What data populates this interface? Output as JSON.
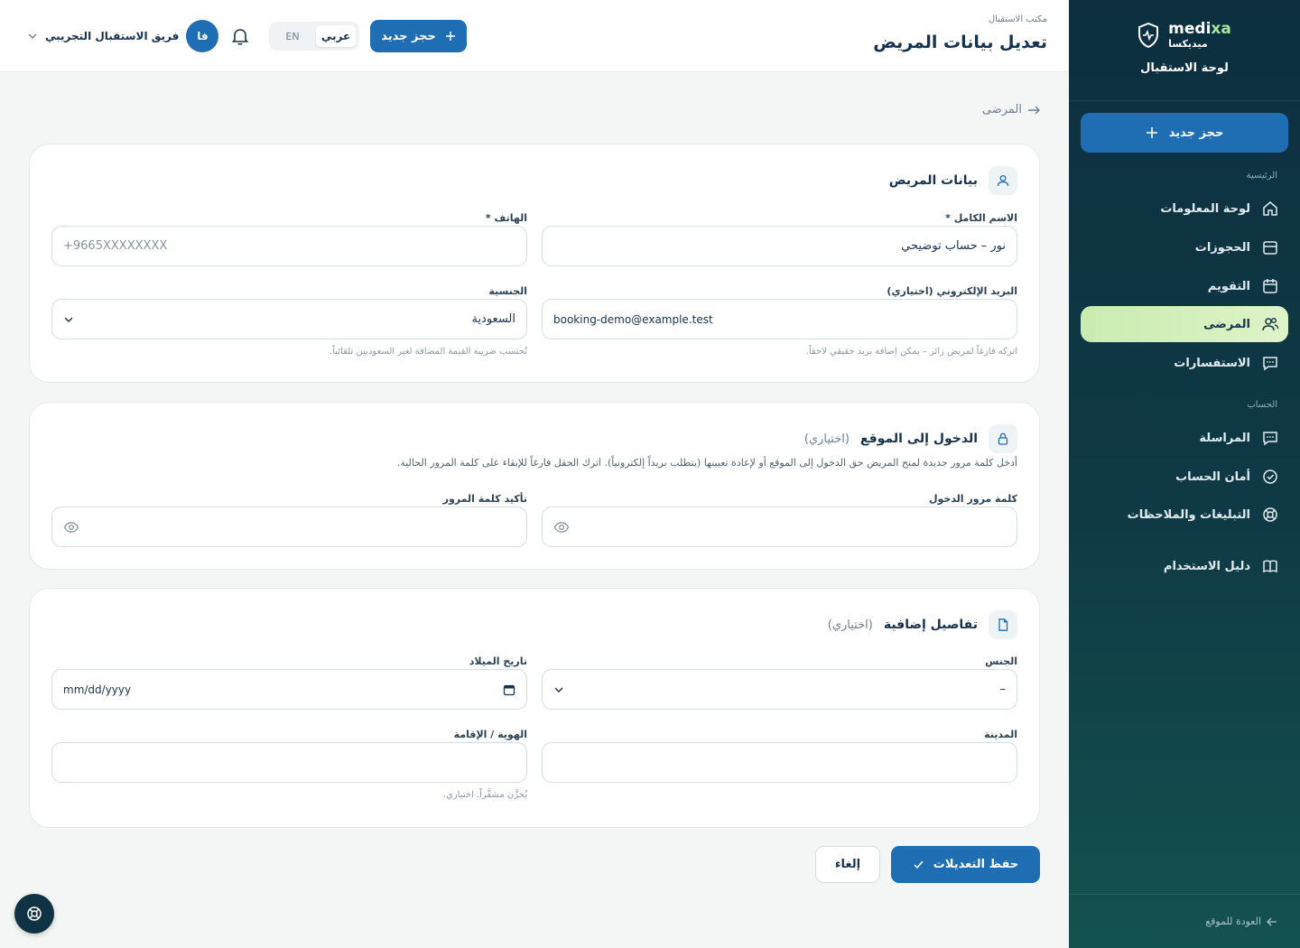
{
  "sidebar": {
    "brand_name_a": "medi",
    "brand_name_b": "xa",
    "brand_name_ar": "ميديكسا",
    "panel_title": "لوحة الاستقبال",
    "new_booking": "حجز جديد",
    "section_main": "الرئيسية",
    "section_account": "الحساب",
    "items": [
      {
        "label": "لوحة المعلومات",
        "icon": "home-icon"
      },
      {
        "label": "الحجوزات",
        "icon": "bookings-icon"
      },
      {
        "label": "التقويم",
        "icon": "calendar-icon"
      },
      {
        "label": "المرضى",
        "icon": "users-icon",
        "active": true
      },
      {
        "label": "الاستفسارات",
        "icon": "chat-icon"
      },
      {
        "label": "المراسلة",
        "icon": "message-icon"
      },
      {
        "label": "أمان الحساب",
        "icon": "shield-check-icon"
      },
      {
        "label": "التبليغات والملاحظات",
        "icon": "lifebuoy-icon"
      },
      {
        "label": "دليل الاستخدام",
        "icon": "book-icon"
      }
    ],
    "back_to_site": "العودة للموقع"
  },
  "topbar": {
    "crumb": "مكتب الاستقبال",
    "title": "تعديل بيانات المريض",
    "new_booking": "حجز جديد",
    "lang_ar": "عربي",
    "lang_en": "EN",
    "user_name": "فريق الاستقبال التجريبي",
    "user_initials": "فا"
  },
  "back_link": "المرضى",
  "patient_card": {
    "title": "بيانات المريض",
    "full_name_label": "الاسم الكامل *",
    "full_name_value": "نور – حساب توضيحي",
    "phone_label": "الهاتف *",
    "phone_placeholder": "+9665XXXXXXXX",
    "email_label": "البريد الإلكتروني (اختياري)",
    "email_value": "booking-demo@example.test",
    "email_hint": "اتركه فارغاً لمريض زائر – يمكن إضافة بريد حقيقي لاحقاً.",
    "nationality_label": "الجنسية",
    "nationality_value": "السعودية",
    "nationality_hint": "تُحتسب ضريبة القيمة المضافة لغير السعوديين تلقائياً."
  },
  "login_card": {
    "title": "الدخول إلى الموقع",
    "optional": "(اختياري)",
    "description": "أدخل كلمة مرور جديدة لمنح المريض حق الدخول إلى الموقع أو لإعادة تعيينها (يتطلب بريداً إلكترونياً). اترك الحقل فارغاً للإبقاء على كلمة المرور الحالية.",
    "password_label": "كلمة مرور الدخول",
    "confirm_label": "تأكيد كلمة المرور"
  },
  "extra_card": {
    "title": "تفاصيل إضافية",
    "optional": "(اختياري)",
    "gender_label": "الجنس",
    "gender_value": "–",
    "dob_label": "تاريخ الميلاد",
    "dob_placeholder": "mm/dd/yyyy",
    "city_label": "المدينة",
    "id_label": "الهوية / الإقامة",
    "id_hint": "يُخزَّن مشفَّراً. اختياري."
  },
  "actions": {
    "save": "حفظ التعديلات",
    "cancel": "إلغاء"
  }
}
